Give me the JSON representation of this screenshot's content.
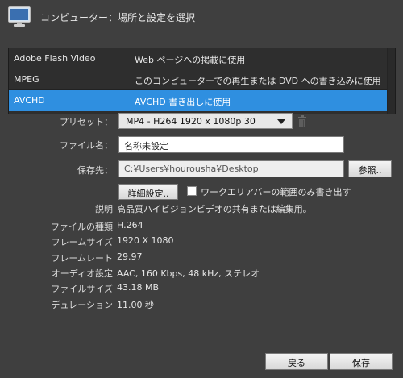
{
  "header": {
    "title": "コンピューター：場所と設定を選択",
    "icon": "monitor-icon"
  },
  "formats": [
    {
      "name": "Adobe Flash Video",
      "description": "Web ページへの掲載に使用"
    },
    {
      "name": "MPEG",
      "description": "このコンピューターでの再生または DVD への書き込みに使用"
    },
    {
      "name": "AVCHD",
      "description": "AVCHD 書き出しに使用",
      "selected": true
    }
  ],
  "preset": {
    "label": "プリセット：",
    "value": "MP4 - H264 1920 x 1080p 30"
  },
  "filename": {
    "label": "ファイル名：",
    "value": "名称未設定"
  },
  "save_to": {
    "label": "保存先：",
    "value": "C:¥Users¥hourousha¥Desktop",
    "browse_label": "参照.."
  },
  "advanced_button": "詳細設定..",
  "work_area_only": {
    "label": "ワークエリアバーの範囲のみ書き出す",
    "checked": false
  },
  "details": [
    {
      "label": "説明",
      "value": "高品質ハイビジョンビデオの共有または編集用。"
    },
    {
      "label": "ファイルの種類",
      "value": "H.264"
    },
    {
      "label": "フレームサイズ",
      "value": "1920 X 1080"
    },
    {
      "label": "フレームレート",
      "value": "29.97"
    },
    {
      "label": "オーディオ設定",
      "value": "AAC, 160 Kbps, 48 kHz, ステレオ"
    },
    {
      "label": "ファイルサイズ",
      "value": "43.18 MB"
    },
    {
      "label": "デュレーション",
      "value": "11.00 秒"
    }
  ],
  "footer": {
    "back_label": "戻る",
    "save_label": "保存"
  },
  "colors": {
    "background": "#3f3f3f",
    "selected_row": "#2f8fe0",
    "list_background": "#2e2e2e"
  }
}
